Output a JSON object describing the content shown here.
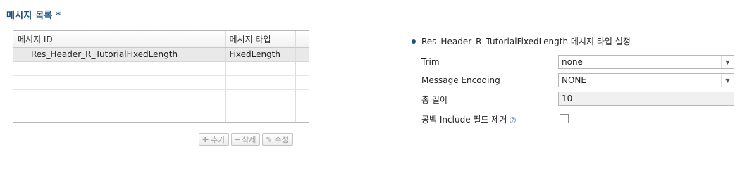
{
  "section_title": "메시지 목록 *",
  "table": {
    "headers": [
      "메시지 ID",
      "메시지 타입"
    ],
    "rows": [
      {
        "id": "Res_Header_R_TutorialFixedLength",
        "type": "FixedLength"
      }
    ]
  },
  "buttons": {
    "add": "추가",
    "delete": "삭제",
    "edit": "수정"
  },
  "panel": {
    "title": "Res_Header_R_TutorialFixedLength 메시지 타입 설정",
    "trim_label": "Trim",
    "trim_value": "none",
    "encoding_label": "Message Encoding",
    "encoding_value": "NONE",
    "length_label": "총 길이",
    "length_value": "10",
    "remove_include_label": "공백 Include 필드 제거",
    "remove_include_checked": false
  },
  "colors": {
    "accent": "#1f4e79",
    "selected_row": "#e9e9e9"
  }
}
